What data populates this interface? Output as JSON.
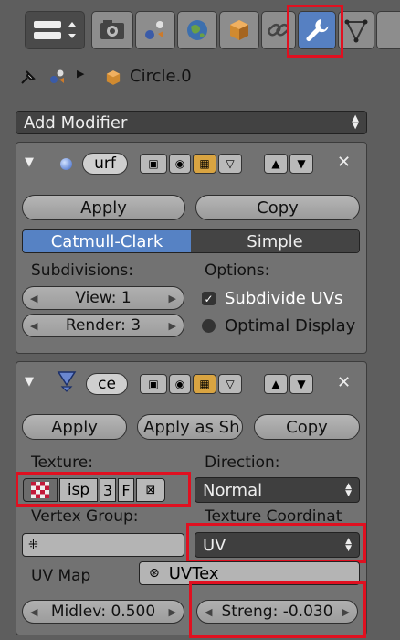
{
  "context_tabs": [
    "menu-toggle-icon",
    "render-icon",
    "scene-icon",
    "world-icon",
    "object-icon",
    "constraints-icon",
    "modifiers-wrench-icon",
    "data-vertex-icon"
  ],
  "breadcrumb": {
    "object_name": "Circle.0"
  },
  "add_modifier": {
    "label": "Add Modifier"
  },
  "modifier1": {
    "name": "urf",
    "apply_label": "Apply",
    "copy_label": "Copy",
    "mode_catmull": "Catmull-Clark",
    "mode_simple": "Simple",
    "subdivisions_label": "Subdivisions:",
    "options_label": "Options:",
    "view_value": "View: 1",
    "render_value": "Render: 3",
    "subdivide_uvs": "Subdivide UVs",
    "optimal_display": "Optimal Display"
  },
  "modifier2": {
    "name": "ce",
    "apply_label": "Apply",
    "apply_shape_label": "Apply as Sh",
    "copy_label": "Copy",
    "texture_label": "Texture:",
    "texture_name": "isp",
    "texture_users": "3",
    "texture_fake": "F",
    "direction_label": "Direction:",
    "direction_value": "Normal",
    "vertex_group_label": "Vertex Group:",
    "texture_coords_label": "Texture Coordinat",
    "texture_coords_value": "UV",
    "uv_map_label": "UV Map",
    "uv_map_value": "UVTex",
    "midlevel_value": "Midlev: 0.500",
    "strength_value": "Streng: -0.030"
  },
  "colors": {
    "active_tab": "#5680c2",
    "highlight": "#e01020",
    "panel": "#727272",
    "background": "#5e5e5e"
  }
}
